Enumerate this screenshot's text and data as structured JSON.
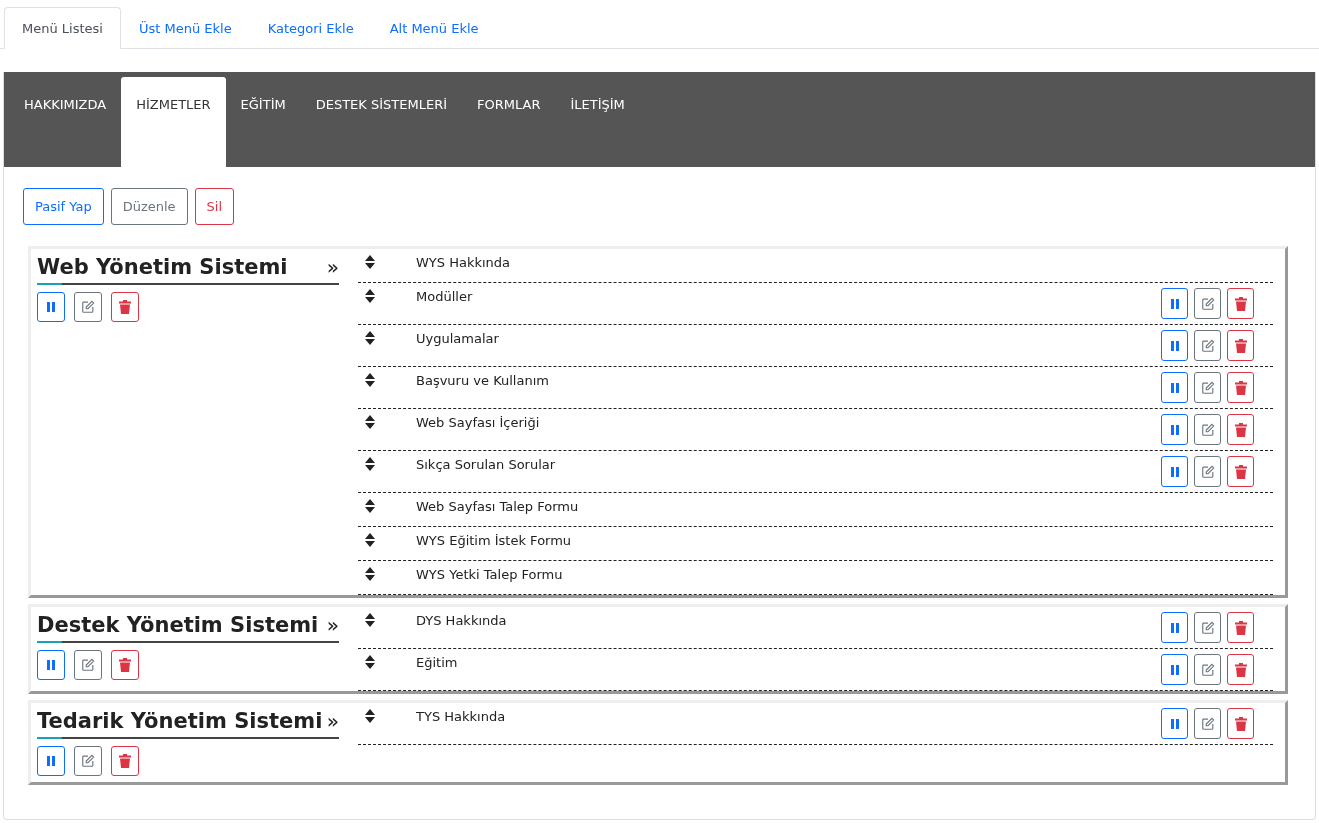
{
  "top_tabs": [
    {
      "label": "Menü Listesi",
      "selected": true
    },
    {
      "label": "Üst Menü Ekle",
      "selected": false
    },
    {
      "label": "Kategori Ekle",
      "selected": false
    },
    {
      "label": "Alt Menü Ekle",
      "selected": false
    }
  ],
  "menu_tabs": [
    {
      "label": "HAKKIMIZDA",
      "selected": false
    },
    {
      "label": "HİZMETLER",
      "selected": true
    },
    {
      "label": "EĞİTİM",
      "selected": false
    },
    {
      "label": "DESTEK SİSTEMLERİ",
      "selected": false
    },
    {
      "label": "FORMLAR",
      "selected": false
    },
    {
      "label": "İLETİŞİM",
      "selected": false
    }
  ],
  "toolbar": [
    {
      "label": "Pasif Yap",
      "kind": "primary"
    },
    {
      "label": "Düzenle",
      "kind": "secondary"
    },
    {
      "label": "Sil",
      "kind": "danger"
    }
  ],
  "categories": [
    {
      "title": "Web Yönetim Sistemi",
      "arrow": "»",
      "items": [
        {
          "label": "WYS Hakkında",
          "actions": false
        },
        {
          "label": "Modüller",
          "actions": true
        },
        {
          "label": "Uygulamalar",
          "actions": true
        },
        {
          "label": "Başvuru ve Kullanım",
          "actions": true
        },
        {
          "label": "Web Sayfası İçeriği",
          "actions": true
        },
        {
          "label": "Sıkça Sorulan Sorular",
          "actions": true
        },
        {
          "label": "Web Sayfası Talep Formu",
          "actions": false
        },
        {
          "label": "WYS Eğitim İstek Formu",
          "actions": false
        },
        {
          "label": "WYS Yetki Talep Formu",
          "actions": false
        }
      ]
    },
    {
      "title": "Destek Yönetim Sistemi",
      "arrow": "»",
      "items": [
        {
          "label": "DYS Hakkında",
          "actions": true
        },
        {
          "label": "Eğitim",
          "actions": true
        }
      ]
    },
    {
      "title": "Tedarik Yönetim Sistemi",
      "arrow": "»",
      "items": [
        {
          "label": "TYS Hakkında",
          "actions": true
        }
      ]
    }
  ]
}
